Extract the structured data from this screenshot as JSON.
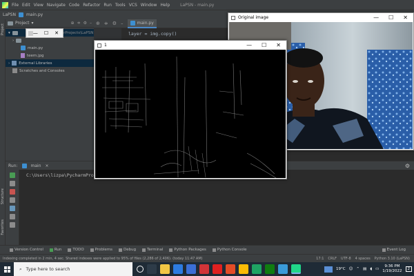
{
  "ide": {
    "app_name": "LaPSN",
    "file_name": "main.py",
    "menu": [
      "File",
      "Edit",
      "View",
      "Navigate",
      "Code",
      "Refactor",
      "Run",
      "Tools",
      "VCS",
      "Window",
      "Help"
    ],
    "title": "LaPSN - main.py",
    "project_label": "Project",
    "project_path": "erProjects\\LaPSN",
    "tree": [
      {
        "label": "main.py",
        "icon": "python-file-icon"
      },
      {
        "label": "teem.jpg",
        "icon": "image-file-icon"
      },
      {
        "label": "External Libraries",
        "icon": "library-icon"
      },
      {
        "label": "Scratches and Consoles",
        "icon": "scratch-icon"
      }
    ],
    "editor_tab": "main.py",
    "code_line": "layer = img.copy()",
    "run_label": "Run:",
    "run_tab": "main",
    "run_output": "C:\\Users\\lizpa\\PycharmProje",
    "tool_windows": [
      "Version Control",
      "Run",
      "TODO",
      "Problems",
      "Debug",
      "Terminal",
      "Python Packages",
      "Python Console"
    ],
    "event_log": "Event Log",
    "status_message": "Indexing completed in 2 min, 4 sec. Shared indexes were applied to 95% of files (2,286 of 2,406). (today 11:47 AM)",
    "status_right": [
      "17:1",
      "CRLF",
      "UTF-8",
      "4 spaces",
      "Python 3.10 (LaPSN)"
    ],
    "side_labels": [
      "Project",
      "Structure",
      "Favorites"
    ]
  },
  "windows": {
    "original_title": "Original image",
    "edges_title": "1",
    "controls": [
      "—",
      "☐",
      "✕"
    ]
  },
  "taskbar": {
    "search_placeholder": "Type here to search",
    "weather": "19°C",
    "time": "9:36 PM",
    "date": "1/19/2022",
    "notifications": "2"
  },
  "colors": {
    "ide_bg": "#2b2b2b",
    "panel_bg": "#3c3f41",
    "taskbar_bg": "#1f2b36",
    "accent": "#4a88c7"
  }
}
